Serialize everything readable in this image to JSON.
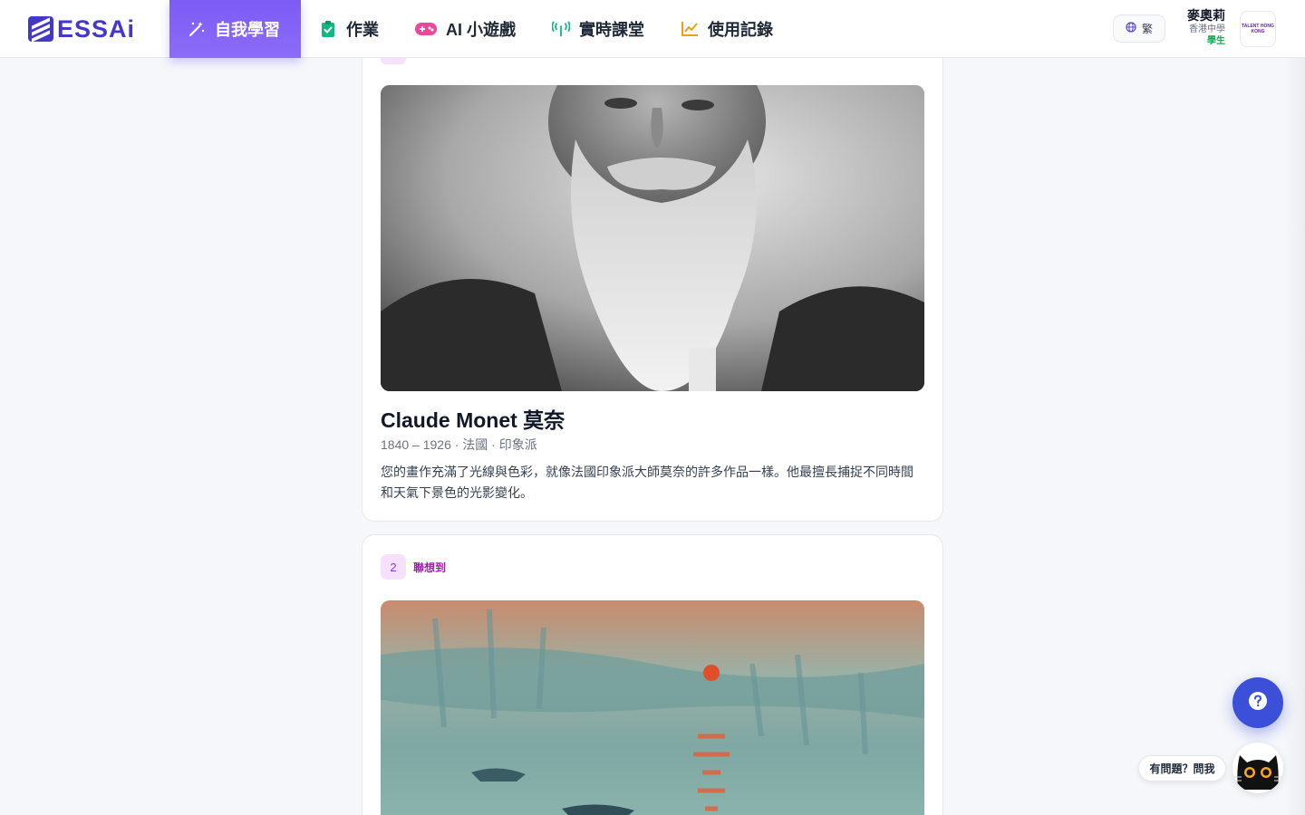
{
  "brand": {
    "logo_text": "ESSA",
    "logo_suffix": "i"
  },
  "nav": {
    "items": [
      {
        "label": "自我學習",
        "icon": "magic-wand-icon",
        "active": true
      },
      {
        "label": "作業",
        "icon": "clipboard-check-icon",
        "active": false
      },
      {
        "label": "AI 小遊戲",
        "icon": "gamepad-icon",
        "active": false
      },
      {
        "label": "實時課堂",
        "icon": "broadcast-icon",
        "active": false
      },
      {
        "label": "使用記錄",
        "icon": "chart-line-icon",
        "active": false
      }
    ]
  },
  "language": {
    "label": "繁",
    "icon": "globe-icon"
  },
  "user": {
    "name": "麥奧莉",
    "school": "香港中學",
    "role": "學生",
    "school_logo_text": "TALENT HONG KONG"
  },
  "cards": [
    {
      "artist_name": "Claude Monet 莫奈",
      "meta": "1840 – 1926 · 法國 · 印象派",
      "description": "您的畫作充滿了光線與色彩，就像法國印象派大師莫奈的許多作品一樣。他最擅長捕捉不同時間和天氣下景色的光影變化。"
    },
    {
      "rank": "2",
      "rank_label": "聯想到"
    }
  ],
  "help": {
    "fab_icon": "question-icon",
    "ask_label": "有問題？問我",
    "cat_icon": "cat-mascot-icon"
  },
  "colors": {
    "accent": "#7c5cf5",
    "brand": "#4338ca",
    "help": "#3b4fd8",
    "role": "#16a34a"
  }
}
